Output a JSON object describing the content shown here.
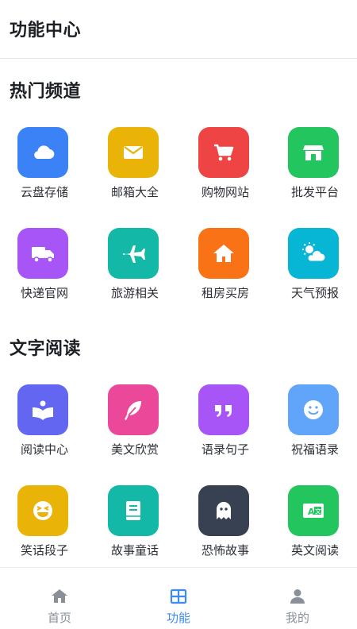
{
  "header": {
    "title": "功能中心"
  },
  "sections": [
    {
      "title": "热门频道",
      "items": [
        {
          "label": "云盘存储",
          "icon": "cloud-icon",
          "color": "#3b82f6"
        },
        {
          "label": "邮箱大全",
          "icon": "envelope-icon",
          "color": "#eab308"
        },
        {
          "label": "购物网站",
          "icon": "cart-icon",
          "color": "#ef4444"
        },
        {
          "label": "批发平台",
          "icon": "store-icon",
          "color": "#22c55e"
        },
        {
          "label": "快递官网",
          "icon": "truck-icon",
          "color": "#a855f7"
        },
        {
          "label": "旅游相关",
          "icon": "plane-icon",
          "color": "#14b8a6"
        },
        {
          "label": "租房买房",
          "icon": "home-icon",
          "color": "#f97316"
        },
        {
          "label": "天气预报",
          "icon": "weather-icon",
          "color": "#06b6d4"
        }
      ]
    },
    {
      "title": "文字阅读",
      "items": [
        {
          "label": "阅读中心",
          "icon": "reader-icon",
          "color": "#6366f1"
        },
        {
          "label": "美文欣赏",
          "icon": "feather-icon",
          "color": "#ec4899"
        },
        {
          "label": "语录句子",
          "icon": "quote-icon",
          "color": "#a855f7"
        },
        {
          "label": "祝福语录",
          "icon": "smile-icon",
          "color": "#60a5fa"
        },
        {
          "label": "笑话段子",
          "icon": "laugh-icon",
          "color": "#eab308"
        },
        {
          "label": "故事童话",
          "icon": "book-icon",
          "color": "#14b8a6"
        },
        {
          "label": "恐怖故事",
          "icon": "ghost-icon",
          "color": "#374151"
        },
        {
          "label": "英文阅读",
          "icon": "translate-icon",
          "color": "#22c55e"
        }
      ]
    }
  ],
  "tabbar": {
    "active": 1,
    "tabs": [
      {
        "label": "首页",
        "icon": "home-tab-icon"
      },
      {
        "label": "功能",
        "icon": "grid-tab-icon"
      },
      {
        "label": "我的",
        "icon": "user-tab-icon"
      }
    ],
    "active_color": "#3d8bf0",
    "inactive_color": "#8a9099"
  }
}
